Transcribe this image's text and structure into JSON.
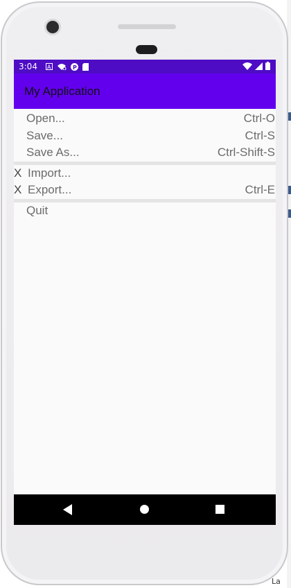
{
  "status_bar": {
    "time": "3:04",
    "left_icons": [
      "a-notification-icon",
      "wifi-notification-icon",
      "p-notification-icon",
      "sd-card-icon"
    ],
    "right_icons": [
      "wifi-signal-icon",
      "cell-signal-icon",
      "battery-icon"
    ]
  },
  "app_bar": {
    "title": "My Application"
  },
  "menu": {
    "group1": [
      {
        "label": "Open...",
        "shortcut": "Ctrl-O"
      },
      {
        "label": "Save...",
        "shortcut": "Ctrl-S"
      },
      {
        "label": "Save As...",
        "shortcut": "Ctrl-Shift-S"
      }
    ],
    "group2": [
      {
        "mark": "X",
        "label": "Import...",
        "shortcut": ""
      },
      {
        "mark": "X",
        "label": "Export...",
        "shortcut": "Ctrl-E"
      }
    ],
    "group3": [
      {
        "label": "Quit"
      }
    ]
  },
  "nav_bar": {
    "icons": [
      "back-icon",
      "home-icon",
      "recents-icon"
    ]
  },
  "corner_text": "La",
  "colors": {
    "status_bar": "#4e0cc5",
    "app_bar": "#6200ee",
    "screen_bg": "#fafafa"
  }
}
